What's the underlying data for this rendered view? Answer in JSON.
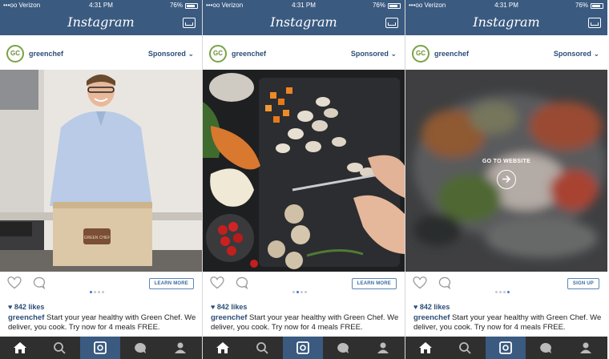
{
  "status": {
    "carrier": "•••oo Verizon",
    "time": "4:31 PM",
    "battery": "76%"
  },
  "app": {
    "title": "Instagram"
  },
  "post": {
    "avatar_initials": "GC",
    "username": "greenchef",
    "sponsored_label": "Sponsored",
    "likes": "842 likes",
    "caption_user": "greenchef",
    "caption_text": "Start your year healthy with Green Chef. We deliver, you cook. Try now for 4 meals FREE.",
    "box_label": "GREEN CHEF"
  },
  "screens": [
    {
      "cta": "LEARN MORE",
      "active_dot": 0
    },
    {
      "cta": "LEARN MORE",
      "active_dot": 1
    },
    {
      "cta": "SIGN UP",
      "active_dot": 3,
      "overlay_text": "GO TO WEBSITE"
    }
  ],
  "colors": {
    "brand": "#3a5a80",
    "accent": "#3a7bd5",
    "text_blue": "#2b4d78",
    "tabbar": "#2f2f2f"
  },
  "icons": [
    "home-icon",
    "search-icon",
    "camera-icon",
    "activity-icon",
    "profile-icon",
    "heart-icon",
    "comment-icon",
    "inbox-icon",
    "arrow-right-icon"
  ]
}
